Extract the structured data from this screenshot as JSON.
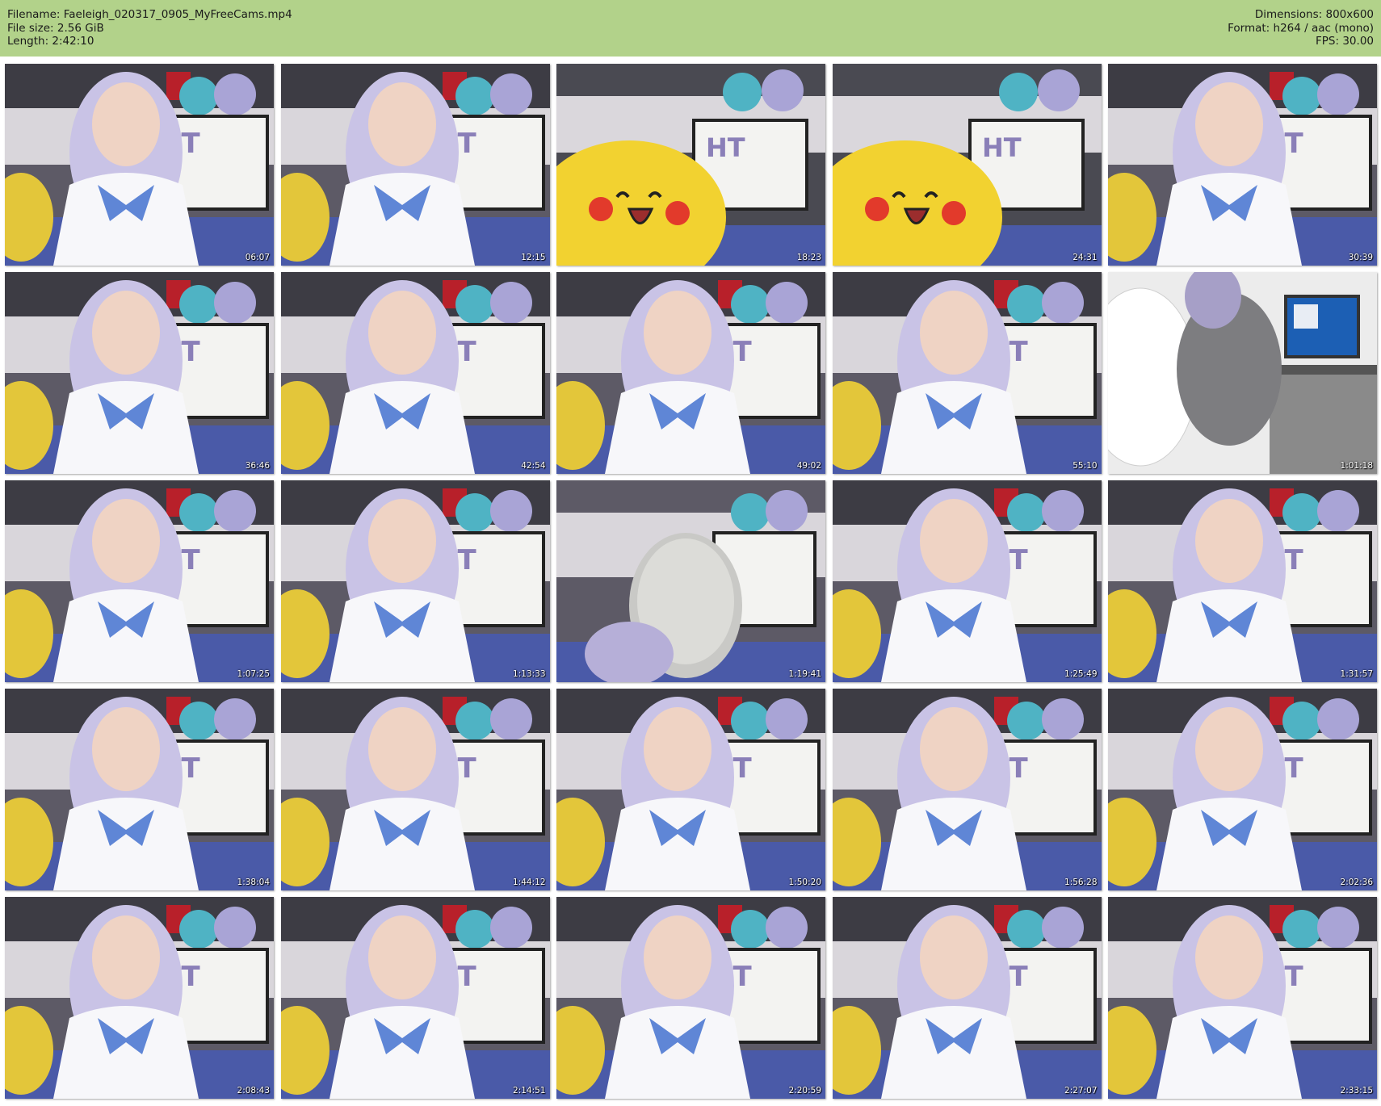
{
  "header": {
    "filename": "Filename: Faeleigh_020317_0905_MyFreeCams.mp4",
    "filesize": "File size: 2.56 GiB",
    "length": "Length: 2:42:10",
    "dimensions": "Dimensions: 800x600",
    "format": "Format: h264 / aac (mono)",
    "fps": "FPS: 30.00"
  },
  "colors": {
    "header_bg": "#b2d28a",
    "page_bg": "#ffffff",
    "timestamp": "#ffffff"
  },
  "thumbnails": [
    {
      "time": "06:07",
      "scene": "person-whiteboard"
    },
    {
      "time": "12:15",
      "scene": "person-whiteboard"
    },
    {
      "time": "18:23",
      "scene": "pikachu-pillow"
    },
    {
      "time": "24:31",
      "scene": "pikachu-pillow"
    },
    {
      "time": "30:39",
      "scene": "person-whiteboard"
    },
    {
      "time": "36:46",
      "scene": "person-whiteboard"
    },
    {
      "time": "42:54",
      "scene": "person-whiteboard"
    },
    {
      "time": "49:02",
      "scene": "person-whiteboard"
    },
    {
      "time": "55:10",
      "scene": "person-whiteboard"
    },
    {
      "time": "1:01:18",
      "scene": "computer-desk"
    },
    {
      "time": "1:07:25",
      "scene": "person-whiteboard"
    },
    {
      "time": "1:13:33",
      "scene": "person-whiteboard"
    },
    {
      "time": "1:19:41",
      "scene": "knit-hat-closeup"
    },
    {
      "time": "1:25:49",
      "scene": "person-whiteboard"
    },
    {
      "time": "1:31:57",
      "scene": "person-whiteboard"
    },
    {
      "time": "1:38:04",
      "scene": "person-whiteboard"
    },
    {
      "time": "1:44:12",
      "scene": "person-whiteboard"
    },
    {
      "time": "1:50:20",
      "scene": "person-whiteboard"
    },
    {
      "time": "1:56:28",
      "scene": "person-whiteboard"
    },
    {
      "time": "2:02:36",
      "scene": "person-whiteboard"
    },
    {
      "time": "2:08:43",
      "scene": "person-whiteboard"
    },
    {
      "time": "2:14:51",
      "scene": "person-whiteboard"
    },
    {
      "time": "2:20:59",
      "scene": "person-whiteboard"
    },
    {
      "time": "2:27:07",
      "scene": "person-whiteboard"
    },
    {
      "time": "2:33:15",
      "scene": "person-whiteboard"
    }
  ]
}
